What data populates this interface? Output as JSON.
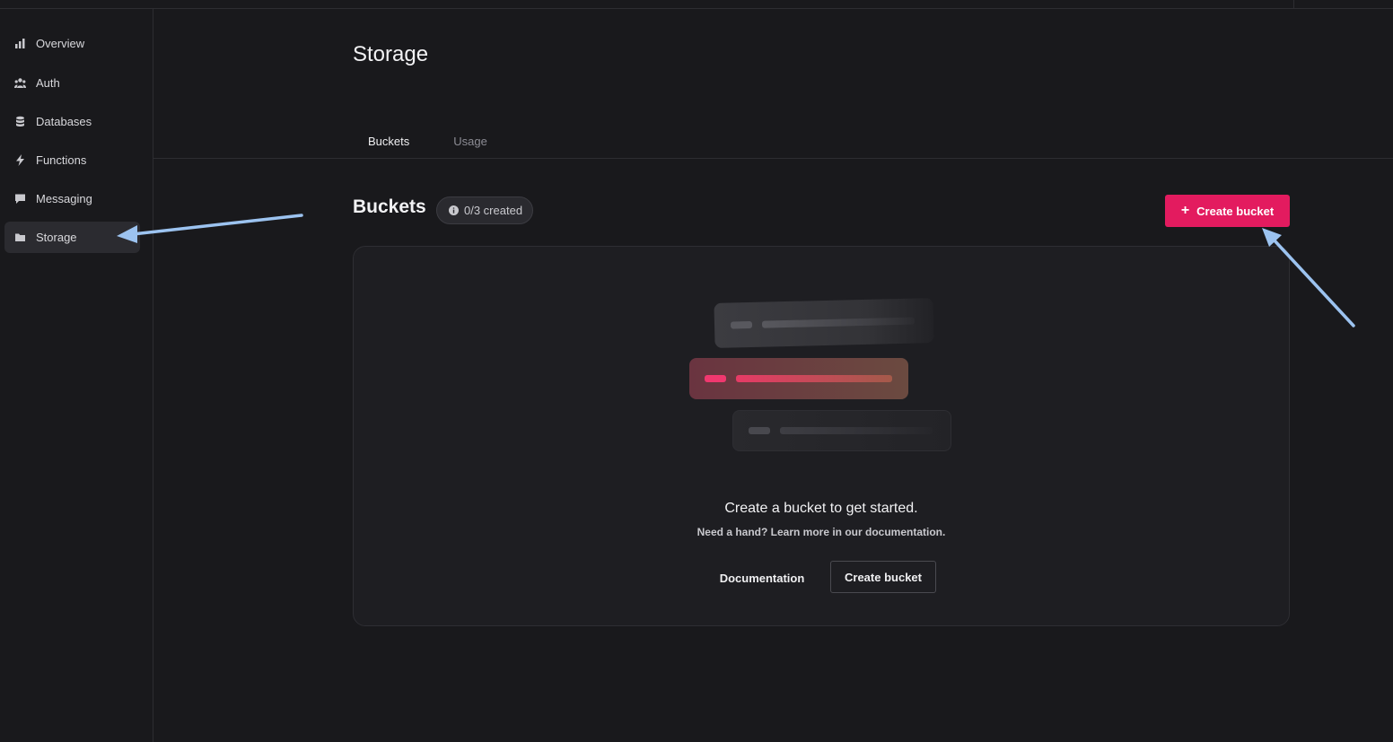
{
  "sidebar": {
    "items": [
      {
        "label": "Overview",
        "icon": "chart-bar-icon",
        "active": false
      },
      {
        "label": "Auth",
        "icon": "users-icon",
        "active": false
      },
      {
        "label": "Databases",
        "icon": "database-icon",
        "active": false
      },
      {
        "label": "Functions",
        "icon": "lightning-icon",
        "active": false
      },
      {
        "label": "Messaging",
        "icon": "chat-icon",
        "active": false
      },
      {
        "label": "Storage",
        "icon": "folder-icon",
        "active": true
      }
    ]
  },
  "header": {
    "title": "Storage",
    "tabs": [
      {
        "label": "Buckets",
        "active": true
      },
      {
        "label": "Usage",
        "active": false
      }
    ]
  },
  "main": {
    "section_title": "Buckets",
    "badge": "0/3 created",
    "create_button": "Create bucket",
    "empty_state": {
      "title": "Create a bucket to get started.",
      "subtitle": "Need a hand? Learn more in our documentation.",
      "documentation_button": "Documentation",
      "create_button": "Create bucket"
    }
  },
  "colors": {
    "accent": "#e31b5f",
    "background": "#19191c",
    "annotation_arrow": "#9cc3f0"
  }
}
